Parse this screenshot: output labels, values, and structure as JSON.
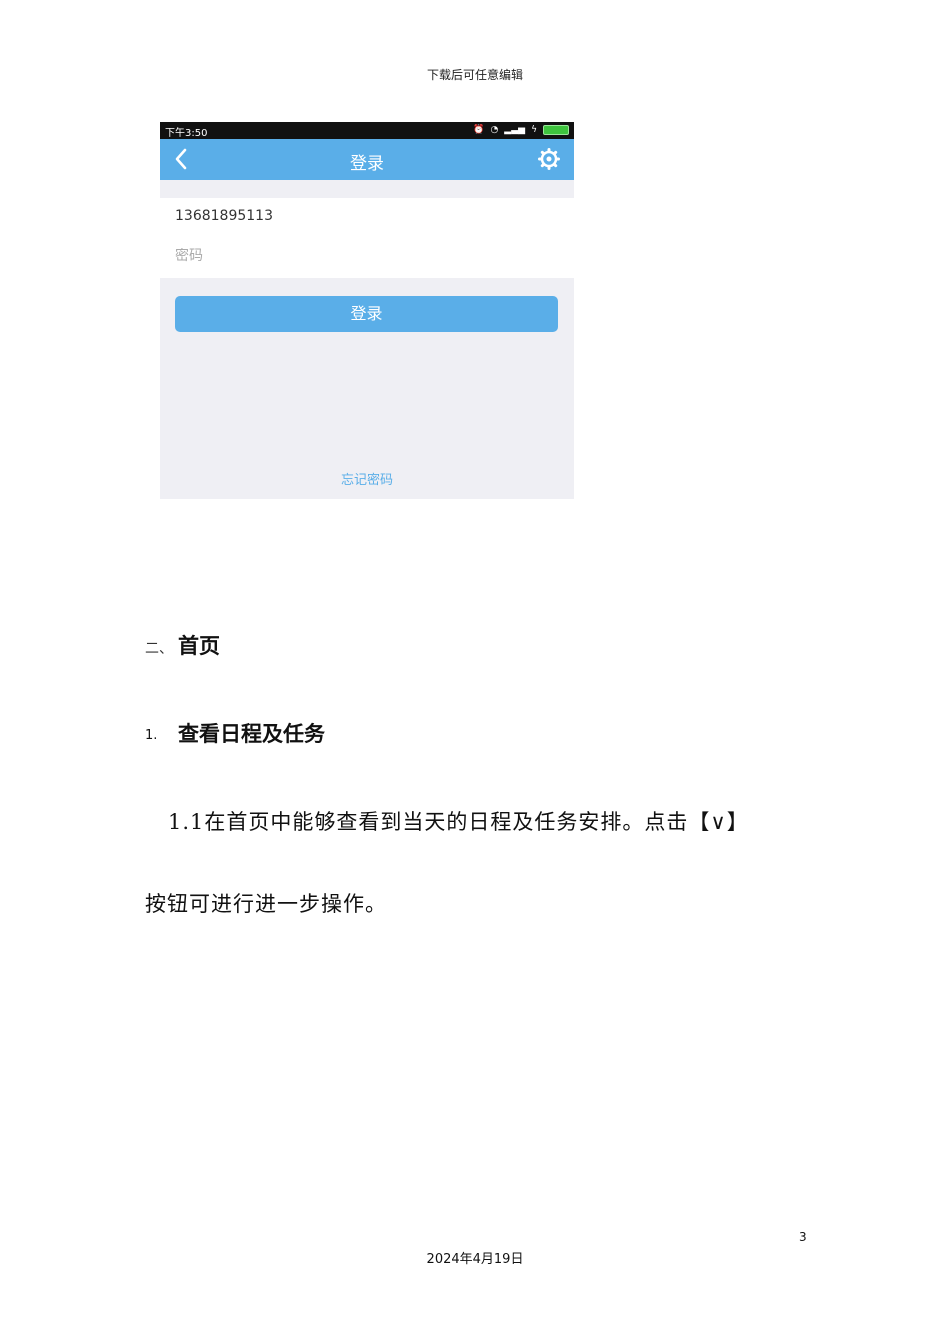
{
  "header": {
    "note": "下载后可任意编辑"
  },
  "screenshot": {
    "status_bar": {
      "time": "下午3:50"
    },
    "title_bar": {
      "title": "登录",
      "back_icon": "chevron-left-icon",
      "settings_icon": "gear-icon"
    },
    "form": {
      "account_value": "13681895113",
      "password_placeholder": "密码",
      "login_button": "登录",
      "forgot_password": "忘记密码"
    },
    "colors": {
      "accent": "#5aaee8",
      "background": "#efeff4",
      "status_bar": "#111111"
    }
  },
  "section": {
    "number": "二、",
    "title": "首页"
  },
  "subsection": {
    "number": "1.",
    "title": "查看日程及任务"
  },
  "paragraph": {
    "line1": "1.1在首页中能够查看到当天的日程及任务安排。点击【∨】",
    "line2": "按钮可进行进一步操作。"
  },
  "footer": {
    "page_number": "3",
    "date": "2024年4月19日"
  }
}
